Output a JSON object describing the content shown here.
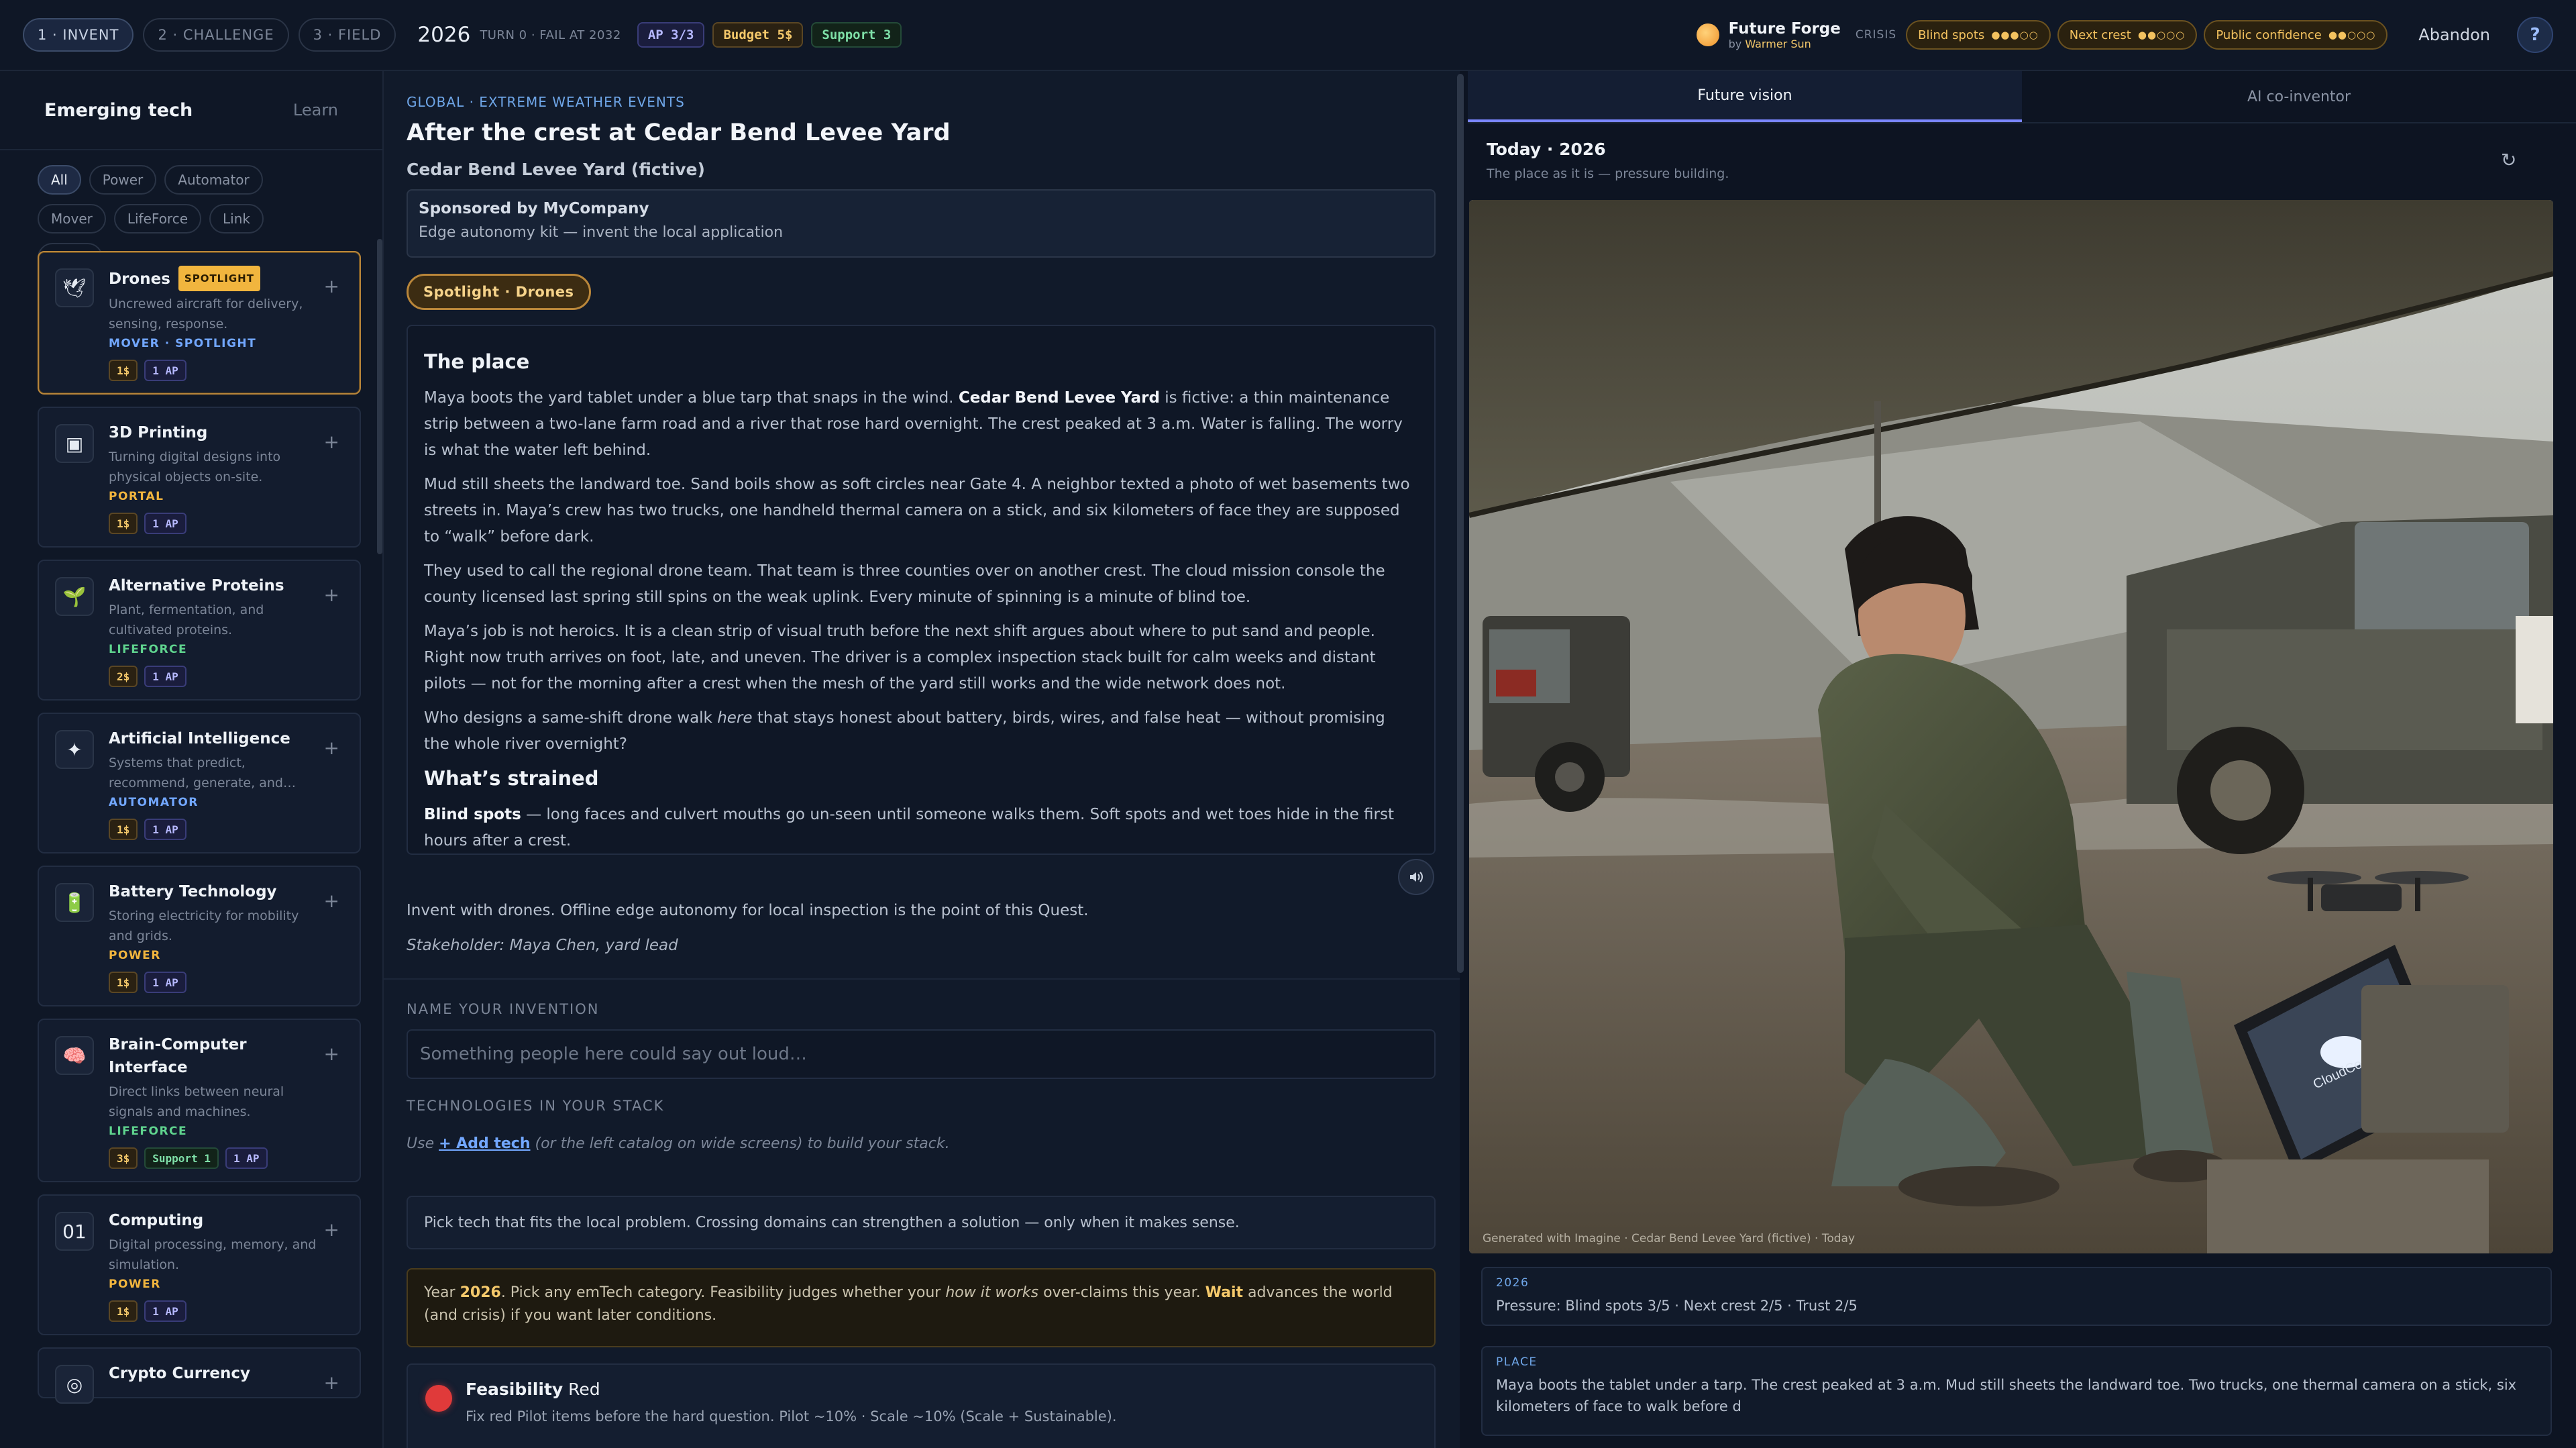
{
  "header": {
    "steps": [
      {
        "label": "1 · INVENT",
        "active": true
      },
      {
        "label": "2 · CHALLENGE",
        "active": false
      },
      {
        "label": "3 · FIELD",
        "active": false
      }
    ],
    "year": "2026",
    "turn": "TURN 0 · FAIL AT 2032",
    "ap": "AP 3/3",
    "budget": "Budget 5$",
    "support": "Support 3",
    "brand_name": "Future Forge",
    "brand_by": "by",
    "brand_author": "Warmer Sun",
    "crisis_label": "CRISIS",
    "crisis": [
      {
        "label": "Blind spots",
        "dots": "●●●○○"
      },
      {
        "label": "Next crest",
        "dots": "●●○○○"
      },
      {
        "label": "Public confidence",
        "dots": "●●○○○"
      }
    ],
    "abandon": "Abandon",
    "help": "?"
  },
  "sidebar": {
    "title": "Emerging tech",
    "learn": "Learn",
    "filters": [
      "All",
      "Power",
      "Automator",
      "Mover",
      "LifeForce",
      "Link",
      "Portal"
    ],
    "active_filter": "All",
    "cards": [
      {
        "name": "Drones",
        "tag": "SPOTLIGHT",
        "icon": "dove-icon",
        "glyph": "🕊",
        "desc": "Uncrewed aircraft for delivery, sensing, response.",
        "cat": "MOVER · SPOTLIGHT",
        "cat_class": "mover",
        "costs": [
          {
            "t": "b",
            "v": "1$"
          },
          {
            "t": "a",
            "v": "1 AP"
          }
        ],
        "spot": true
      },
      {
        "name": "3D Printing",
        "tag": "",
        "icon": "printer-icon",
        "glyph": "▣",
        "desc": "Turning digital designs into physical objects on-site.",
        "cat": "PORTAL",
        "cat_class": "portal",
        "costs": [
          {
            "t": "b",
            "v": "1$"
          },
          {
            "t": "a",
            "v": "1 AP"
          }
        ]
      },
      {
        "name": "Alternative Proteins",
        "tag": "",
        "icon": "sprout-icon",
        "glyph": "🌱",
        "desc": "Plant, fermentation, and cultivated proteins.",
        "cat": "LIFEFORCE",
        "cat_class": "lifeforce",
        "costs": [
          {
            "t": "b",
            "v": "2$"
          },
          {
            "t": "a",
            "v": "1 AP"
          }
        ]
      },
      {
        "name": "Artificial Intelligence",
        "tag": "",
        "icon": "sparkle-icon",
        "glyph": "✦",
        "desc": "Systems that predict, recommend, generate, and…",
        "cat": "AUTOMATOR",
        "cat_class": "automator",
        "costs": [
          {
            "t": "b",
            "v": "1$"
          },
          {
            "t": "a",
            "v": "1 AP"
          }
        ]
      },
      {
        "name": "Battery Technology",
        "tag": "",
        "icon": "battery-icon",
        "glyph": "🔋",
        "desc": "Storing electricity for mobility and grids.",
        "cat": "POWER",
        "cat_class": "power",
        "costs": [
          {
            "t": "b",
            "v": "1$"
          },
          {
            "t": "a",
            "v": "1 AP"
          }
        ]
      },
      {
        "name": "Brain-Computer Interface",
        "tag": "",
        "icon": "brain-icon",
        "glyph": "🧠",
        "desc": "Direct links between neural signals and machines.",
        "cat": "LIFEFORCE",
        "cat_class": "lifeforce",
        "costs": [
          {
            "t": "b",
            "v": "3$"
          },
          {
            "t": "s",
            "v": "Support 1"
          },
          {
            "t": "a",
            "v": "1 AP"
          }
        ]
      },
      {
        "name": "Computing",
        "tag": "",
        "icon": "binary-icon",
        "glyph": "01",
        "desc": "Digital processing, memory, and simulation.",
        "cat": "POWER",
        "cat_class": "power",
        "costs": [
          {
            "t": "b",
            "v": "1$"
          },
          {
            "t": "a",
            "v": "1 AP"
          }
        ]
      },
      {
        "name": "Crypto Currency",
        "tag": "",
        "icon": "coin-icon",
        "glyph": "◎",
        "desc": "",
        "cat": "",
        "cat_class": "",
        "costs": []
      }
    ]
  },
  "center": {
    "crumb": "GLOBAL · EXTREME WEATHER EVENTS",
    "title": "After the crest at Cedar Bend Levee Yard",
    "place": "Cedar Bend Levee Yard (fictive)",
    "sponsor_title": "Sponsored by MyCompany",
    "sponsor_sub": "Edge autonomy kit — invent the local application",
    "spotlight": "Spotlight · Drones",
    "story": {
      "h1": "The place",
      "p1a": "Maya boots the yard tablet under a blue tarp that snaps in the wind. ",
      "p1b": "Cedar Bend Levee Yard",
      "p1c": " is fictive: a thin maintenance strip between a two-lane farm road and a river that rose hard overnight. The crest peaked at 3 a.m. Water is falling. The worry is what the water left behind.",
      "p2": "Mud still sheets the landward toe. Sand boils show as soft circles near Gate 4. A neighbor texted a photo of wet basements two streets in. Maya’s crew has two trucks, one handheld thermal camera on a stick, and six kilometers of face they are supposed to “walk” before dark.",
      "p3": "They used to call the regional drone team. That team is three counties over on another crest. The cloud mission console the county licensed last spring still spins on the weak uplink. Every minute of spinning is a minute of blind toe.",
      "p4": "Maya’s job is not heroics. It is a clean strip of visual truth before the next shift argues about where to put sand and people. Right now truth arrives on foot, late, and uneven. The driver is a complex inspection stack built for calm weeks and distant pilots — not for the morning after a crest when the mesh of the yard still works and the wide network does not.",
      "p5a": "Who designs a same-shift drone walk ",
      "p5b": "here",
      "p5c": " that stays honest about battery, birds, wires, and false heat — without promising the whole river overnight?",
      "h2": "What’s strained",
      "p6a": "Blind spots",
      "p6b": " — long faces and culvert mouths go un-seen until someone walks them. Soft spots and wet toes hide in the first hours after a crest."
    },
    "invent": "Invent with drones. Offline edge autonomy for local inspection is the point of this Quest.",
    "stakeholder": "Stakeholder: Maya Chen, yard lead",
    "name_label": "NAME YOUR INVENTION",
    "name_placeholder": "Something people here could say out loud…",
    "name_value": "",
    "stack_label": "TECHNOLOGIES IN YOUR STACK",
    "use_a": "Use ",
    "use_link": "+ Add tech",
    "use_b": " (or the left catalog on wide screens) to build your stack.",
    "hint": "Pick tech that fits the local problem. Crossing domains can strengthen a solution — only when it makes sense.",
    "year_a": "Year ",
    "year_b": "2026",
    "year_c": ". Pick any emTech category. Feasibility judges whether your ",
    "year_d": "how it works",
    "year_e": " over-claims this year. ",
    "year_f": "Wait",
    "year_g": " advances the world (and crisis) if you want later conditions.",
    "feas_a": "Feasibility",
    "feas_b": " Red",
    "feas_sub": "Fix red Pilot items before the hard question. Pilot ~10% · Scale ~10% (Scale + Sustainable)."
  },
  "right": {
    "tabs": [
      "Future vision",
      "AI co-inventor"
    ],
    "active_tab": "Future vision",
    "today": "Today · 2026",
    "today_sub": "The place as it is — pressure building.",
    "caption": "Generated with Imagine · Cedar Bend Levee Yard (fictive) · Today",
    "info1_k": "2026",
    "info1_v": "Pressure: Blind spots 3/5 · Next crest 2/5 · Trust 2/5",
    "info2_k": "PLACE",
    "info2_v": "Maya boots the tablet under a tarp. The crest peaked at 3 a.m. Mud still sheets the landward toe. Two trucks, one thermal camera on a stick, six kilometers of face to walk before d",
    "tablet_logo": "CloudConsole"
  },
  "colors": {
    "accent": "#7a86ff",
    "gold": "#f1b53e",
    "link": "#72a7ff",
    "feasibility": "#e03a3a"
  }
}
